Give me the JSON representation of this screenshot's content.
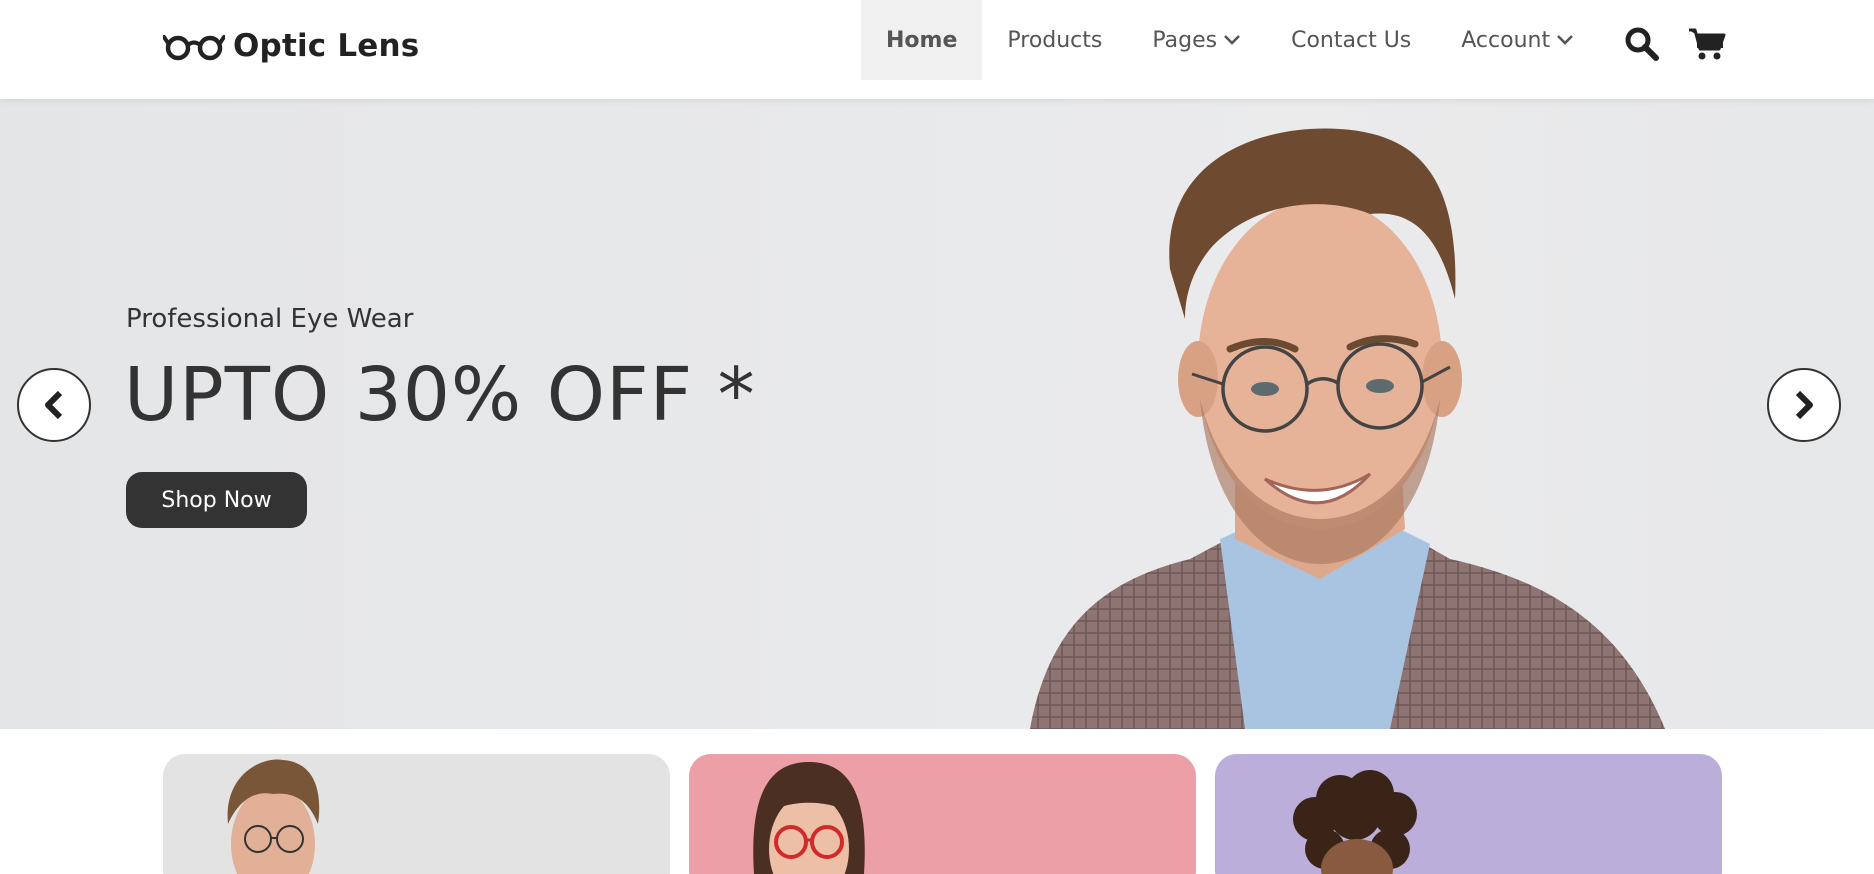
{
  "brand": {
    "name": "Optic Lens",
    "icon": "glasses-icon"
  },
  "nav": {
    "items": [
      {
        "label": "Home",
        "active": true
      },
      {
        "label": "Products"
      },
      {
        "label": "Pages",
        "dropdown": true
      },
      {
        "label": "Contact Us"
      },
      {
        "label": "Account",
        "dropdown": true
      }
    ],
    "icons": [
      "search-icon",
      "cart-icon"
    ]
  },
  "hero": {
    "subtitle": "Professional Eye Wear",
    "title": "UPTO 30% OFF *",
    "cta_label": "Shop Now",
    "prev_icon": "chevron-left-icon",
    "next_icon": "chevron-right-icon"
  },
  "cards": [
    {
      "color": "#e3e3e3"
    },
    {
      "color": "#ec9fa7"
    },
    {
      "color": "#bbaedb"
    }
  ],
  "colors": {
    "dark": "#333333",
    "active_nav_bg": "#f0f0f0"
  }
}
